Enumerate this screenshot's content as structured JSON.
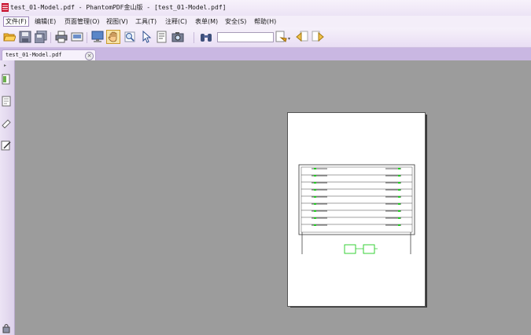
{
  "window": {
    "title": "test_01-Model.pdf - PhantomPDF金山版 - [test_01-Model.pdf]"
  },
  "menu": [
    {
      "label": "文件(F)"
    },
    {
      "label": "编辑(E)"
    },
    {
      "label": "页面管理(O)"
    },
    {
      "label": "视图(V)"
    },
    {
      "label": "工具(T)"
    },
    {
      "label": "注释(C)"
    },
    {
      "label": "表单(M)"
    },
    {
      "label": "安全(S)"
    },
    {
      "label": "帮助(H)"
    }
  ],
  "toolbar": {
    "search_value": "",
    "icons": [
      "open-icon",
      "save-icon",
      "save-all-icon",
      "print-icon",
      "email-icon",
      "screen-icon",
      "hand-icon",
      "zoom-icon",
      "select-icon",
      "text-select-icon",
      "snapshot-icon",
      "find-icon",
      "comment-icon",
      "prev-icon",
      "next-icon"
    ]
  },
  "tabs": [
    {
      "label": "test_01-Model.pdf",
      "close": "×"
    }
  ],
  "colors": {
    "accent": "#c9b7e2",
    "canvas": "#9c9c9c",
    "diagram_green": "#22cc22"
  }
}
